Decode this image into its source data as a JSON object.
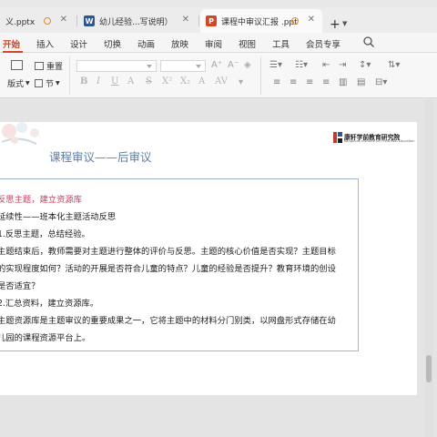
{
  "tabs": [
    {
      "label": "义.pptx"
    },
    {
      "badge": "W",
      "label": "幼儿经验...写说明）"
    },
    {
      "badge": "P",
      "label": "课程中审议汇报 .ppt"
    }
  ],
  "menu": [
    "开始",
    "插入",
    "设计",
    "切换",
    "动画",
    "放映",
    "审阅",
    "视图",
    "工具",
    "会员专享"
  ],
  "ribbon": {
    "reset_label": "重置",
    "layout_label": "版式",
    "section_label": "节"
  },
  "slide": {
    "title": "课程审议——后审议",
    "logo_text": "康轩学前教育研究院",
    "logo_sub": "Kangxuan Institute for Preschool Education",
    "lines": [
      "反思主题，建立资源库",
      "延续性——班本化主题活动反思",
      "1.反思主题，总结经验。",
      "主题结束后，教师需要对主题进行整体的评价与反思。主题的核心价值是否实现？主题目标",
      "的实现程度如何？活动的开展是否符合儿童的特点？儿童的经验是否提升？教育环境的创设",
      "是否适宜？",
      "2.汇总资料，建立资源库。",
      "主题资源库是主题审议的重要成果之一，它将主题中的材料分门别类，以网盘形式存储在幼",
      "儿园的课程资源平台上。"
    ]
  },
  "colors": {
    "accent": "#d24726",
    "title_blue": "#5e7fa8",
    "heading_pink": "#c0415e",
    "word_blue": "#2b5797",
    "ppt_orange": "#d24726"
  }
}
